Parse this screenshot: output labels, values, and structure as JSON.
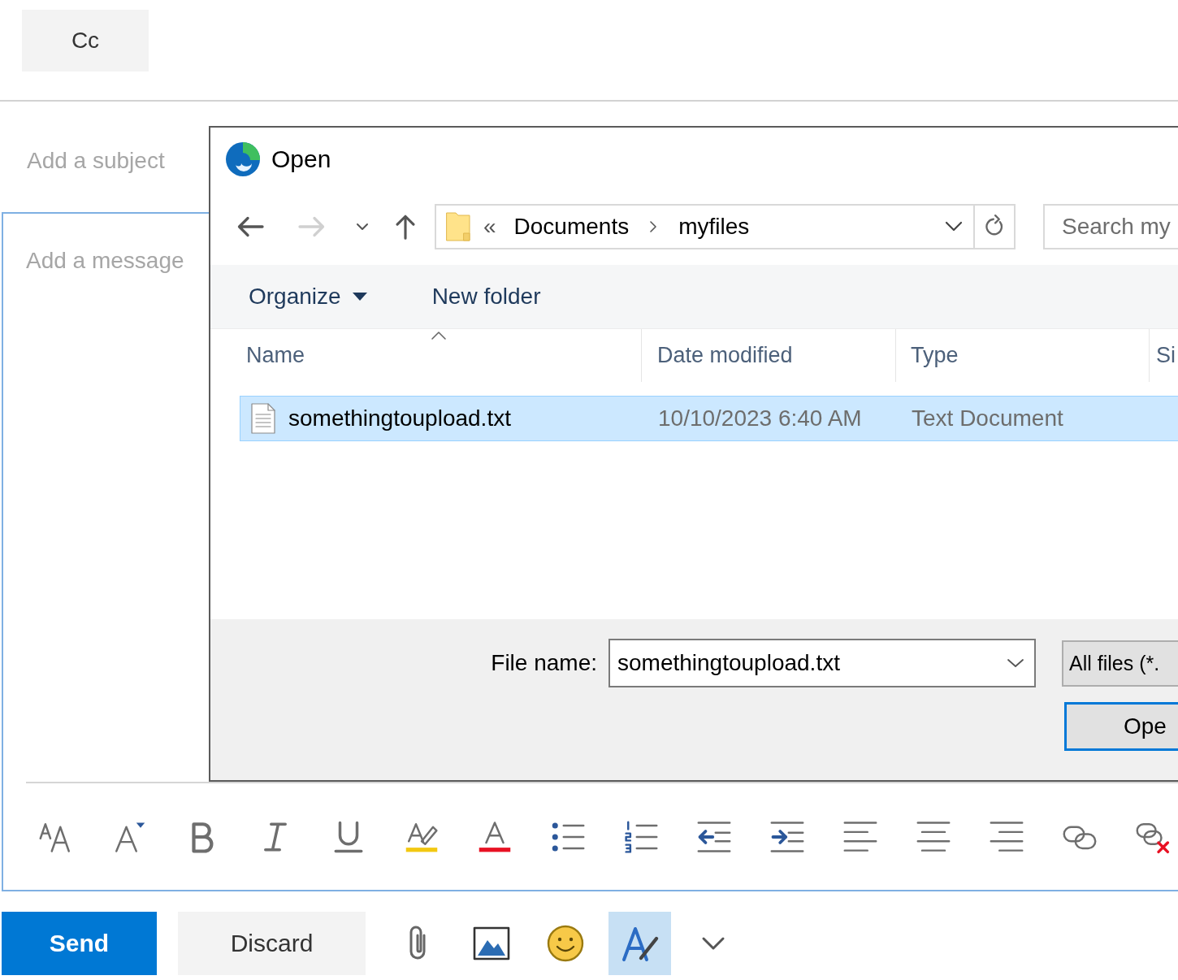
{
  "compose": {
    "cc_label": "Cc",
    "subject": {
      "placeholder": "Add a subject"
    },
    "message": {
      "placeholder": "Add a message",
      "focused": true
    }
  },
  "dialog": {
    "title": "Open",
    "nav_buttons": [
      {
        "kind": "back",
        "disabled": false
      },
      {
        "kind": "forward",
        "disabled": true
      },
      {
        "kind": "recent",
        "disabled": false
      },
      {
        "kind": "up",
        "disabled": false
      }
    ],
    "address": {
      "overflow": "«",
      "segments": [
        "Documents",
        "myfiles"
      ]
    },
    "search": {
      "placeholder": "Search my"
    },
    "commands": [
      {
        "kind": "menu",
        "label": "Organize"
      },
      {
        "kind": "button",
        "label": "New folder"
      }
    ],
    "columns": [
      {
        "label": "Name",
        "sorted": true
      },
      {
        "label": "Date modified",
        "sorted": false
      },
      {
        "label": "Type",
        "sorted": false
      },
      {
        "label": "Si",
        "sorted": false
      }
    ],
    "files": [
      {
        "name": "somethingtoupload.txt",
        "date_modified": "10/10/2023 6:40 AM",
        "type": "Text Document",
        "selected": true
      }
    ],
    "file_name": {
      "label": "File name:",
      "value": "somethingtoupload.txt"
    },
    "file_type": "All files (*.",
    "open_button": {
      "label": "Ope",
      "default": true
    }
  },
  "actions": {
    "send": "Send",
    "discard": "Discard",
    "editor_toggle": {
      "on": true
    }
  }
}
